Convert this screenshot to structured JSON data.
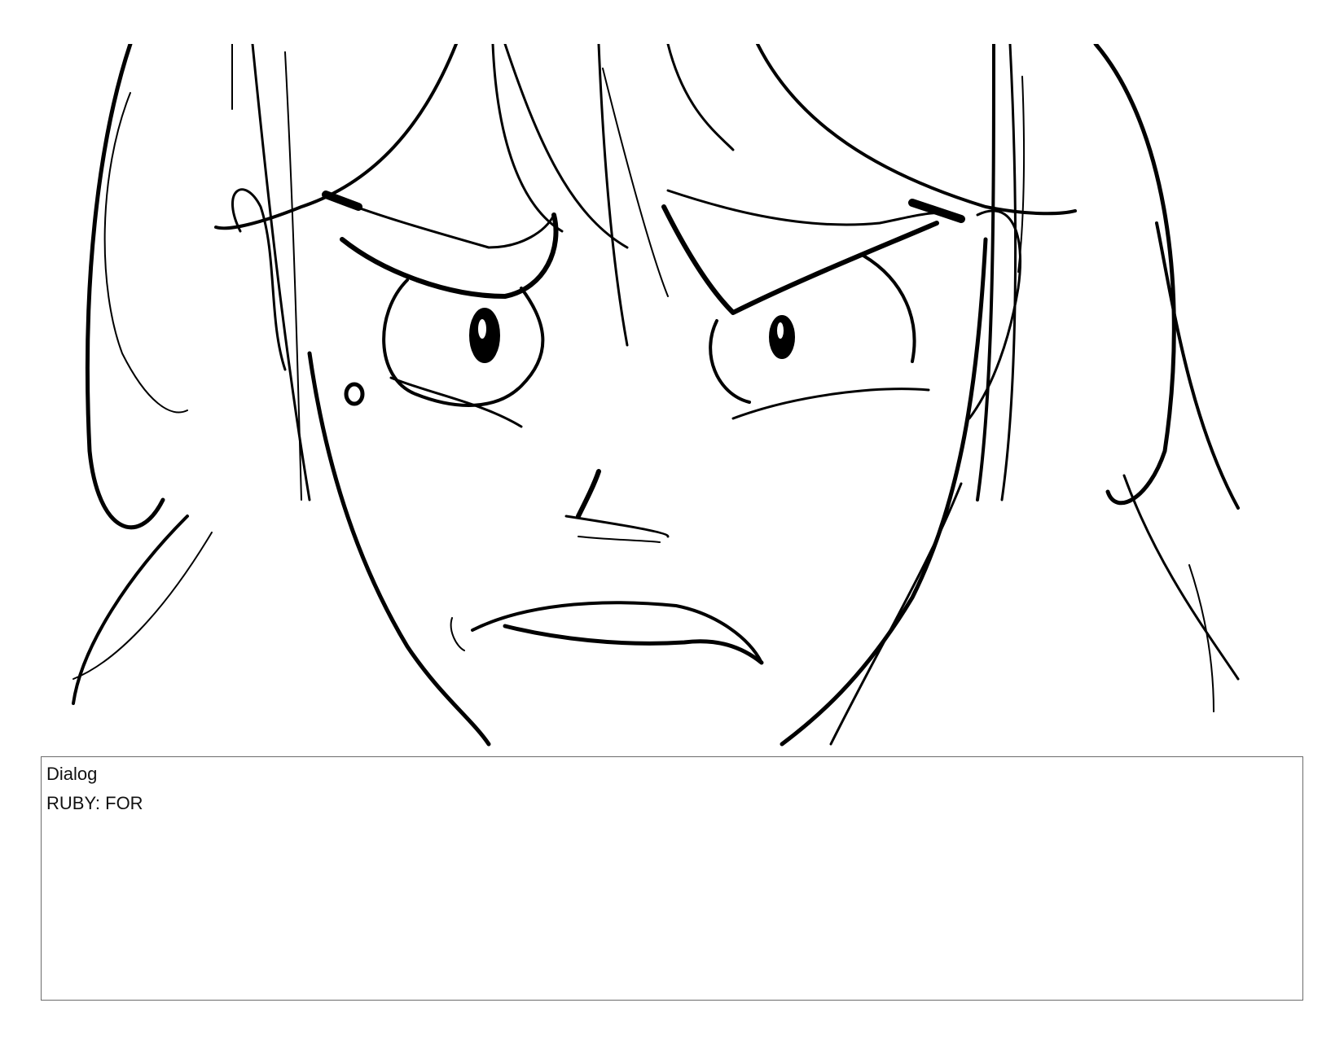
{
  "storyboard_panel": {
    "image_icon": "sketch-angry-girl-closeup"
  },
  "dialog": {
    "label": "Dialog",
    "text": "RUBY: FOR"
  }
}
